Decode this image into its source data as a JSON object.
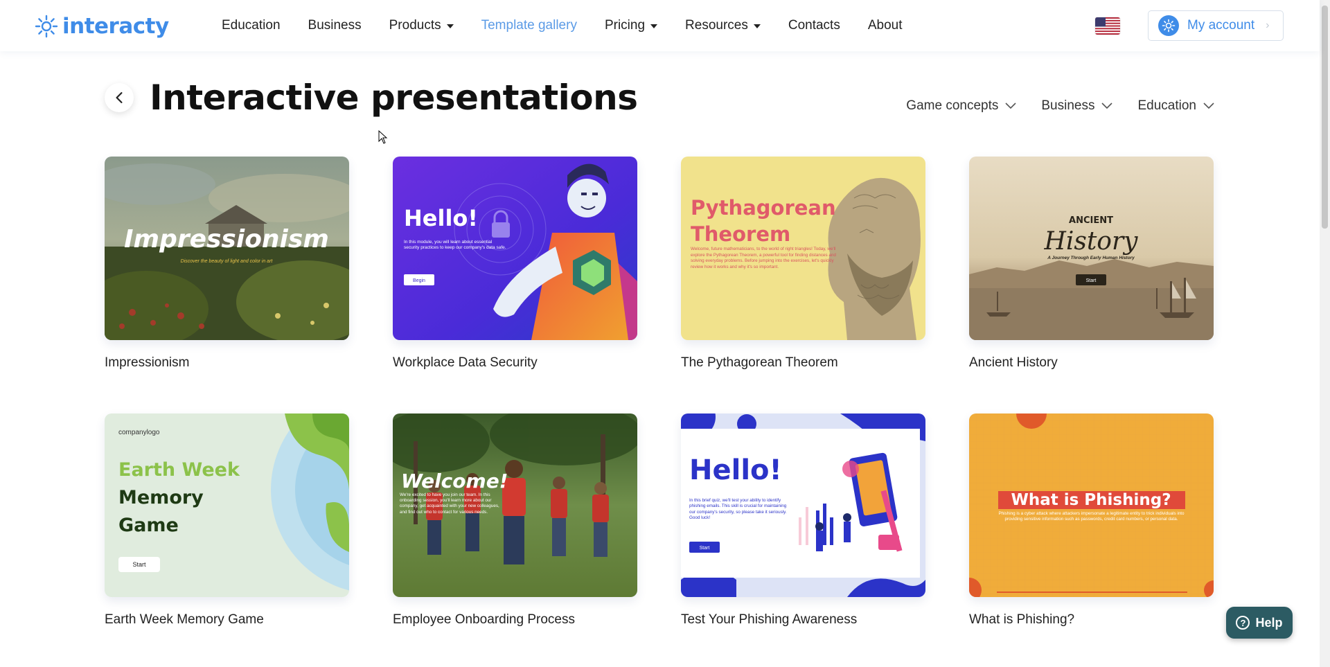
{
  "header": {
    "logo_text": "interacty",
    "nav": [
      {
        "label": "Education",
        "has_menu": false
      },
      {
        "label": "Business",
        "has_menu": false
      },
      {
        "label": "Products",
        "has_menu": true
      },
      {
        "label": "Template gallery",
        "has_menu": false,
        "active": true
      },
      {
        "label": "Pricing",
        "has_menu": true
      },
      {
        "label": "Resources",
        "has_menu": true
      },
      {
        "label": "Contacts",
        "has_menu": false
      },
      {
        "label": "About",
        "has_menu": false
      }
    ],
    "language_flag": "us-flag-icon",
    "account_label": "My account"
  },
  "page": {
    "title": "Interactive presentations",
    "filters": [
      "Game concepts",
      "Business",
      "Education"
    ]
  },
  "cards": [
    {
      "title": "Impressionism",
      "thumb_heading": "Impressionism",
      "thumb_sub": "Discover the beauty of light and color in art"
    },
    {
      "title": "Workplace Data Security",
      "thumb_heading": "Hello!",
      "thumb_body": "In this module, you will learn about essential security practices to keep our company's data safe.",
      "thumb_button": "Begin"
    },
    {
      "title": "The Pythagorean Theorem",
      "thumb_heading": "Pythagorean",
      "thumb_heading2": "Theorem",
      "thumb_body": "Welcome, future mathematicians, to the world of right triangles! Today, we'll explore the Pythagorean Theorem, a powerful tool for finding distances and solving everyday problems. Before jumping into the exercises, let's quickly review how it works and why it's so important."
    },
    {
      "title": "Ancient History",
      "thumb_kicker": "ANCIENT",
      "thumb_heading": "History",
      "thumb_sub": "A Journey Through Early Human History",
      "thumb_button": "Start"
    },
    {
      "title": "Earth Week Memory Game",
      "thumb_logo": "companylogo",
      "thumb_heading": "Earth Week",
      "thumb_heading2": "Memory",
      "thumb_heading3": "Game",
      "thumb_button": "Start"
    },
    {
      "title": "Employee Onboarding Process",
      "thumb_heading": "Welcome!",
      "thumb_body": "We're excited to have you join our team. In this onboarding session, you'll learn more about our company, get acquainted with your new colleagues, and find out who to contact for various needs."
    },
    {
      "title": "Test Your Phishing Awareness",
      "thumb_heading": "Hello!",
      "thumb_body": "In this brief quiz, we'll test your ability to identify phishing emails. This skill is crucial for maintaining our company's security, so please take it seriously. Good luck!",
      "thumb_button": "Start"
    },
    {
      "title": "What is Phishing?",
      "thumb_heading": "What is Phishing?",
      "thumb_body": "Phishing is a cyber attack where attackers impersonate a legitimate entity to trick individuals into providing sensitive information such as passwords, credit card numbers, or personal data."
    }
  ],
  "help": {
    "label": "Help"
  },
  "colors": {
    "brand": "#3f8ce8",
    "active_nav": "#5b9be6",
    "help_bg": "#2c5b63"
  }
}
